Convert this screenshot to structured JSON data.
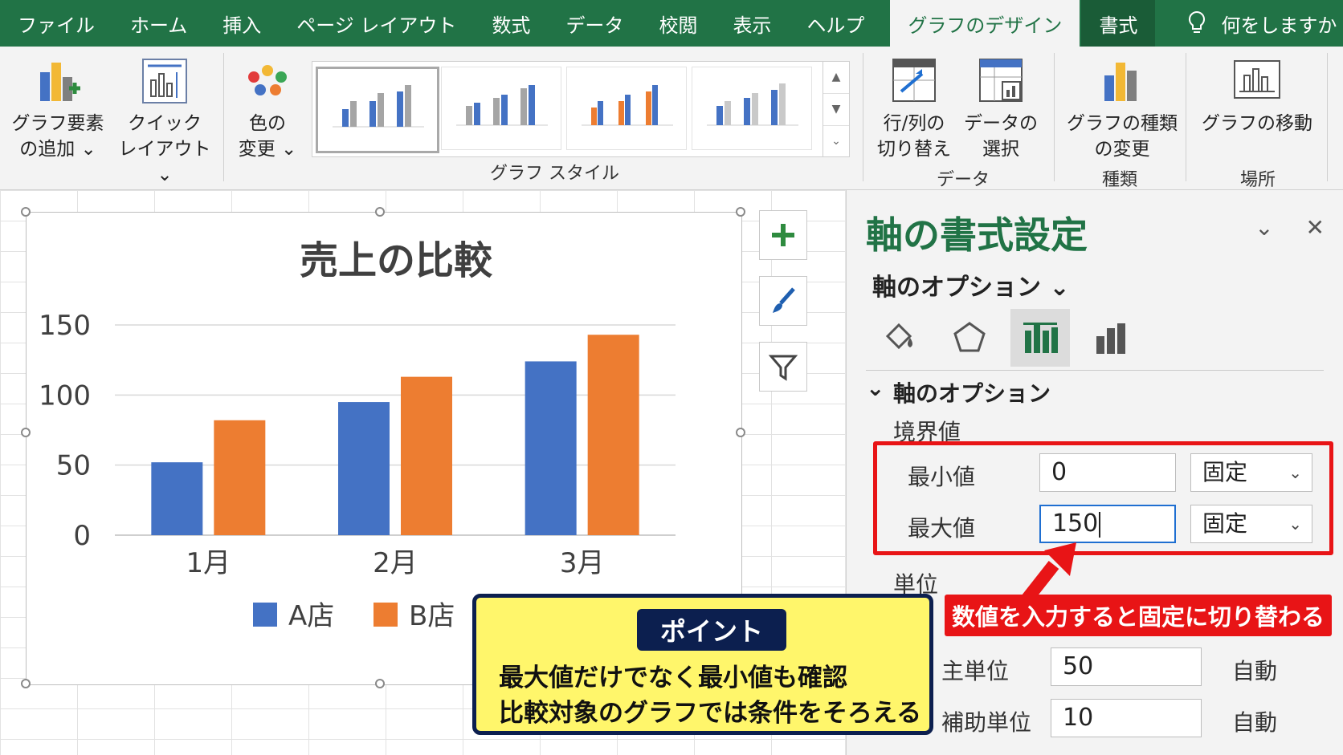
{
  "ribbon_tabs": [
    "ファイル",
    "ホーム",
    "挿入",
    "ページ レイアウト",
    "数式",
    "データ",
    "校閲",
    "表示",
    "ヘルプ"
  ],
  "active_tab": "グラフのデザイン",
  "format_tab": "書式",
  "tell_me": "何をしますか",
  "ribbon": {
    "add_element": [
      "グラフ要素",
      "の追加 ⌄"
    ],
    "quick_layout": [
      "クイック",
      "レイアウト ⌄"
    ],
    "change_colors": [
      "色の",
      "変更 ⌄"
    ],
    "styles_group": "グラフ スタイル",
    "switch_row_col": [
      "行/列の",
      "切り替え"
    ],
    "select_data": [
      "データの",
      "選択"
    ],
    "data_group": "データ",
    "change_type": [
      "グラフの種類",
      "の変更"
    ],
    "type_group": "種類",
    "move_chart": "グラフの移動",
    "location_group": "場所"
  },
  "chart": {
    "title": "売上の比較",
    "colors": {
      "A店": "#4472c4",
      "B店": "#ed7d31"
    }
  },
  "chart_data": {
    "type": "bar",
    "title": "売上の比較",
    "categories": [
      "1月",
      "2月",
      "3月"
    ],
    "series": [
      {
        "name": "A店",
        "values": [
          52,
          95,
          124
        ]
      },
      {
        "name": "B店",
        "values": [
          82,
          113,
          143
        ]
      }
    ],
    "ylim": [
      0,
      150
    ],
    "yticks": [
      0,
      50,
      100,
      150
    ],
    "grid": true,
    "legend": "bottom"
  },
  "pane": {
    "title": "軸の書式設定",
    "options_dropdown": "軸のオプション ⌄",
    "section_title": "軸のオプション",
    "bounds_label": "境界値",
    "min_label": "最小値",
    "min_value": "0",
    "min_mode": "固定",
    "max_label": "最大値",
    "max_value": "150",
    "max_mode": "固定",
    "units_label": "単位",
    "major_label": "主単位",
    "major_value": "50",
    "major_mode": "自動",
    "minor_label": "補助単位",
    "minor_value": "10",
    "minor_mode": "自動"
  },
  "annotation": "数値を入力すると固定に切り替わる",
  "callout": {
    "tag": "ポイント",
    "line1": "最大値だけでなく最小値も確認",
    "line2": "比較対象のグラフでは条件をそろえる"
  }
}
